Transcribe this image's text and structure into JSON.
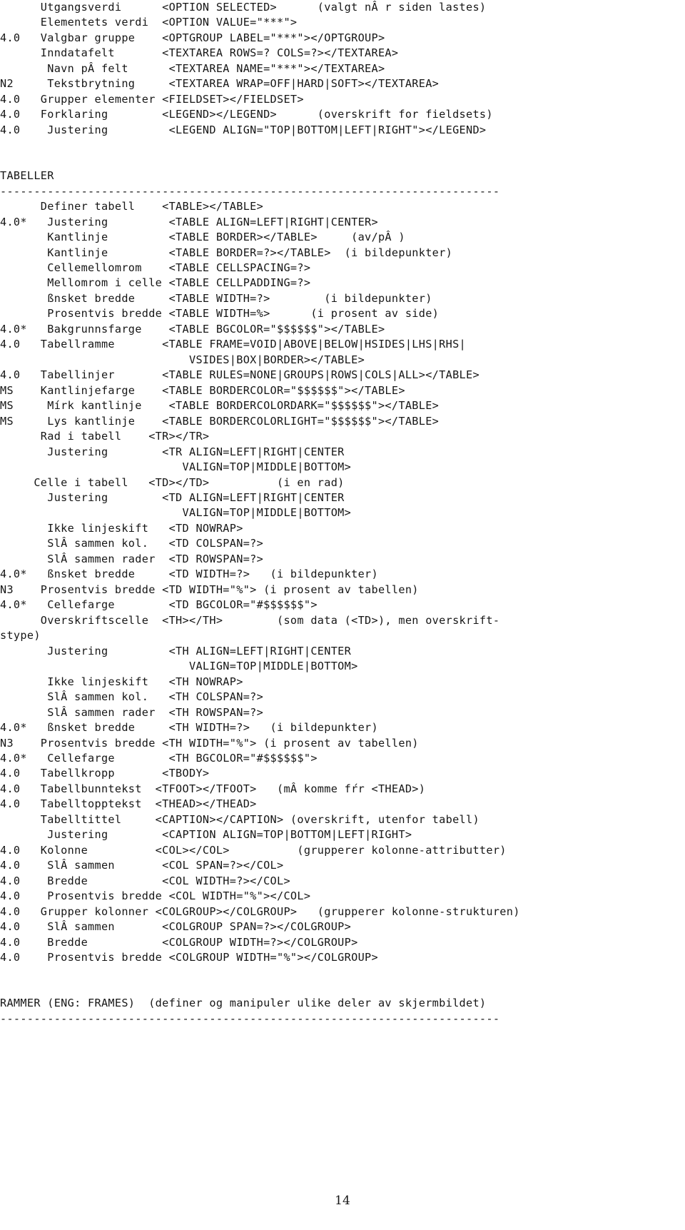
{
  "document": {
    "page_number": "14",
    "lines": [
      "      Utgangsverdi      <OPTION SELECTED>      (valgt nÂ r siden lastes)",
      "      Elementets verdi  <OPTION VALUE=\"***\">",
      "4.0   Valgbar gruppe    <OPTGROUP LABEL=\"***\"></OPTGROUP>",
      "      Inndatafelt       <TEXTAREA ROWS=? COLS=?></TEXTAREA>",
      "       Navn pÂ felt      <TEXTAREA NAME=\"***\"></TEXTAREA>",
      "N2     Tekstbrytning     <TEXTAREA WRAP=OFF|HARD|SOFT></TEXTAREA>",
      "4.0   Grupper elementer <FIELDSET></FIELDSET>",
      "4.0   Forklaring        <LEGEND></LEGEND>      (overskrift for fieldsets)",
      "4.0    Justering         <LEGEND ALIGN=\"TOP|BOTTOM|LEFT|RIGHT\"></LEGEND>",
      "",
      "",
      "TABELLER",
      "RULE",
      "      Definer tabell    <TABLE></TABLE>",
      "4.0*   Justering         <TABLE ALIGN=LEFT|RIGHT|CENTER>",
      "       Kantlinje         <TABLE BORDER></TABLE>     (av/pÂ )",
      "       Kantlinje         <TABLE BORDER=?></TABLE>  (i bildepunkter)",
      "       Cellemellomrom    <TABLE CELLSPACING=?>",
      "       Mellomrom i celle <TABLE CELLPADDING=?>",
      "       ßnsket bredde     <TABLE WIDTH=?>        (i bildepunkter)",
      "       Prosentvis bredde <TABLE WIDTH=%>      (i prosent av side)",
      "4.0*   Bakgrunnsfarge    <TABLE BGCOLOR=\"$$$$$$\"></TABLE>",
      "4.0   Tabellramme       <TABLE FRAME=VOID|ABOVE|BELOW|HSIDES|LHS|RHS|",
      "                            VSIDES|BOX|BORDER></TABLE>",
      "4.0   Tabellinjer       <TABLE RULES=NONE|GROUPS|ROWS|COLS|ALL></TABLE>",
      "MS    Kantlinjefarge    <TABLE BORDERCOLOR=\"$$$$$$\"></TABLE>",
      "MS     Mírk kantlinje    <TABLE BORDERCOLORDARK=\"$$$$$$\"></TABLE>",
      "MS     Lys kantlinje    <TABLE BORDERCOLORLIGHT=\"$$$$$$\"></TABLE>",
      "      Rad i tabell    <TR></TR>",
      "       Justering        <TR ALIGN=LEFT|RIGHT|CENTER",
      "                           VALIGN=TOP|MIDDLE|BOTTOM>",
      "     Celle i tabell   <TD></TD>          (i en rad)",
      "       Justering        <TD ALIGN=LEFT|RIGHT|CENTER",
      "                           VALIGN=TOP|MIDDLE|BOTTOM>",
      "       Ikke linjeskift   <TD NOWRAP>",
      "       SlÂ sammen kol.   <TD COLSPAN=?>",
      "       SlÂ sammen rader  <TD ROWSPAN=?>",
      "4.0*   ßnsket bredde     <TD WIDTH=?>   (i bildepunkter)",
      "N3    Prosentvis bredde <TD WIDTH=\"%\"> (i prosent av tabellen)",
      "4.0*   Cellefarge        <TD BGCOLOR=\"#$$$$$$\">",
      "      Overskriftscelle  <TH></TH>        (som data (<TD>), men overskrift-",
      "stype)",
      "       Justering         <TH ALIGN=LEFT|RIGHT|CENTER",
      "                            VALIGN=TOP|MIDDLE|BOTTOM>",
      "       Ikke linjeskift   <TH NOWRAP>",
      "       SlÂ sammen kol.   <TH COLSPAN=?>",
      "       SlÂ sammen rader  <TH ROWSPAN=?>",
      "4.0*   ßnsket bredde     <TH WIDTH=?>   (i bildepunkter)",
      "N3    Prosentvis bredde <TH WIDTH=\"%\"> (i prosent av tabellen)",
      "4.0*   Cellefarge        <TH BGCOLOR=\"#$$$$$$\">",
      "4.0   Tabellkropp       <TBODY>",
      "4.0   Tabellbunntekst  <TFOOT></TFOOT>   (mÂ komme fŕr <THEAD>)",
      "4.0   Tabelltopptekst  <THEAD></THEAD>",
      "      Tabelltittel     <CAPTION></CAPTION> (overskrift, utenfor tabell)",
      "       Justering        <CAPTION ALIGN=TOP|BOTTOM|LEFT|RIGHT>",
      "4.0   Kolonne          <COL></COL>          (grupperer kolonne-attributter)",
      "4.0    SlÂ sammen       <COL SPAN=?></COL>",
      "4.0    Bredde           <COL WIDTH=?></COL>",
      "4.0    Prosentvis bredde <COL WIDTH=\"%\"></COL>",
      "4.0   Grupper kolonner <COLGROUP></COLGROUP>   (grupperer kolonne-strukturen)",
      "4.0    SlÂ sammen       <COLGROUP SPAN=?></COLGROUP>",
      "4.0    Bredde           <COLGROUP WIDTH=?></COLGROUP>",
      "4.0    Prosentvis bredde <COLGROUP WIDTH=\"%\"></COLGROUP>",
      "",
      "",
      "RAMMER (ENG: FRAMES)  (definer og manipuler ulike deler av skjermbildet)",
      "RULE"
    ],
    "rule_text": "--------------------------------------------------------------------------",
    "section_headings": [
      "TABELLER",
      "RAMMER (ENG: FRAMES)"
    ]
  }
}
